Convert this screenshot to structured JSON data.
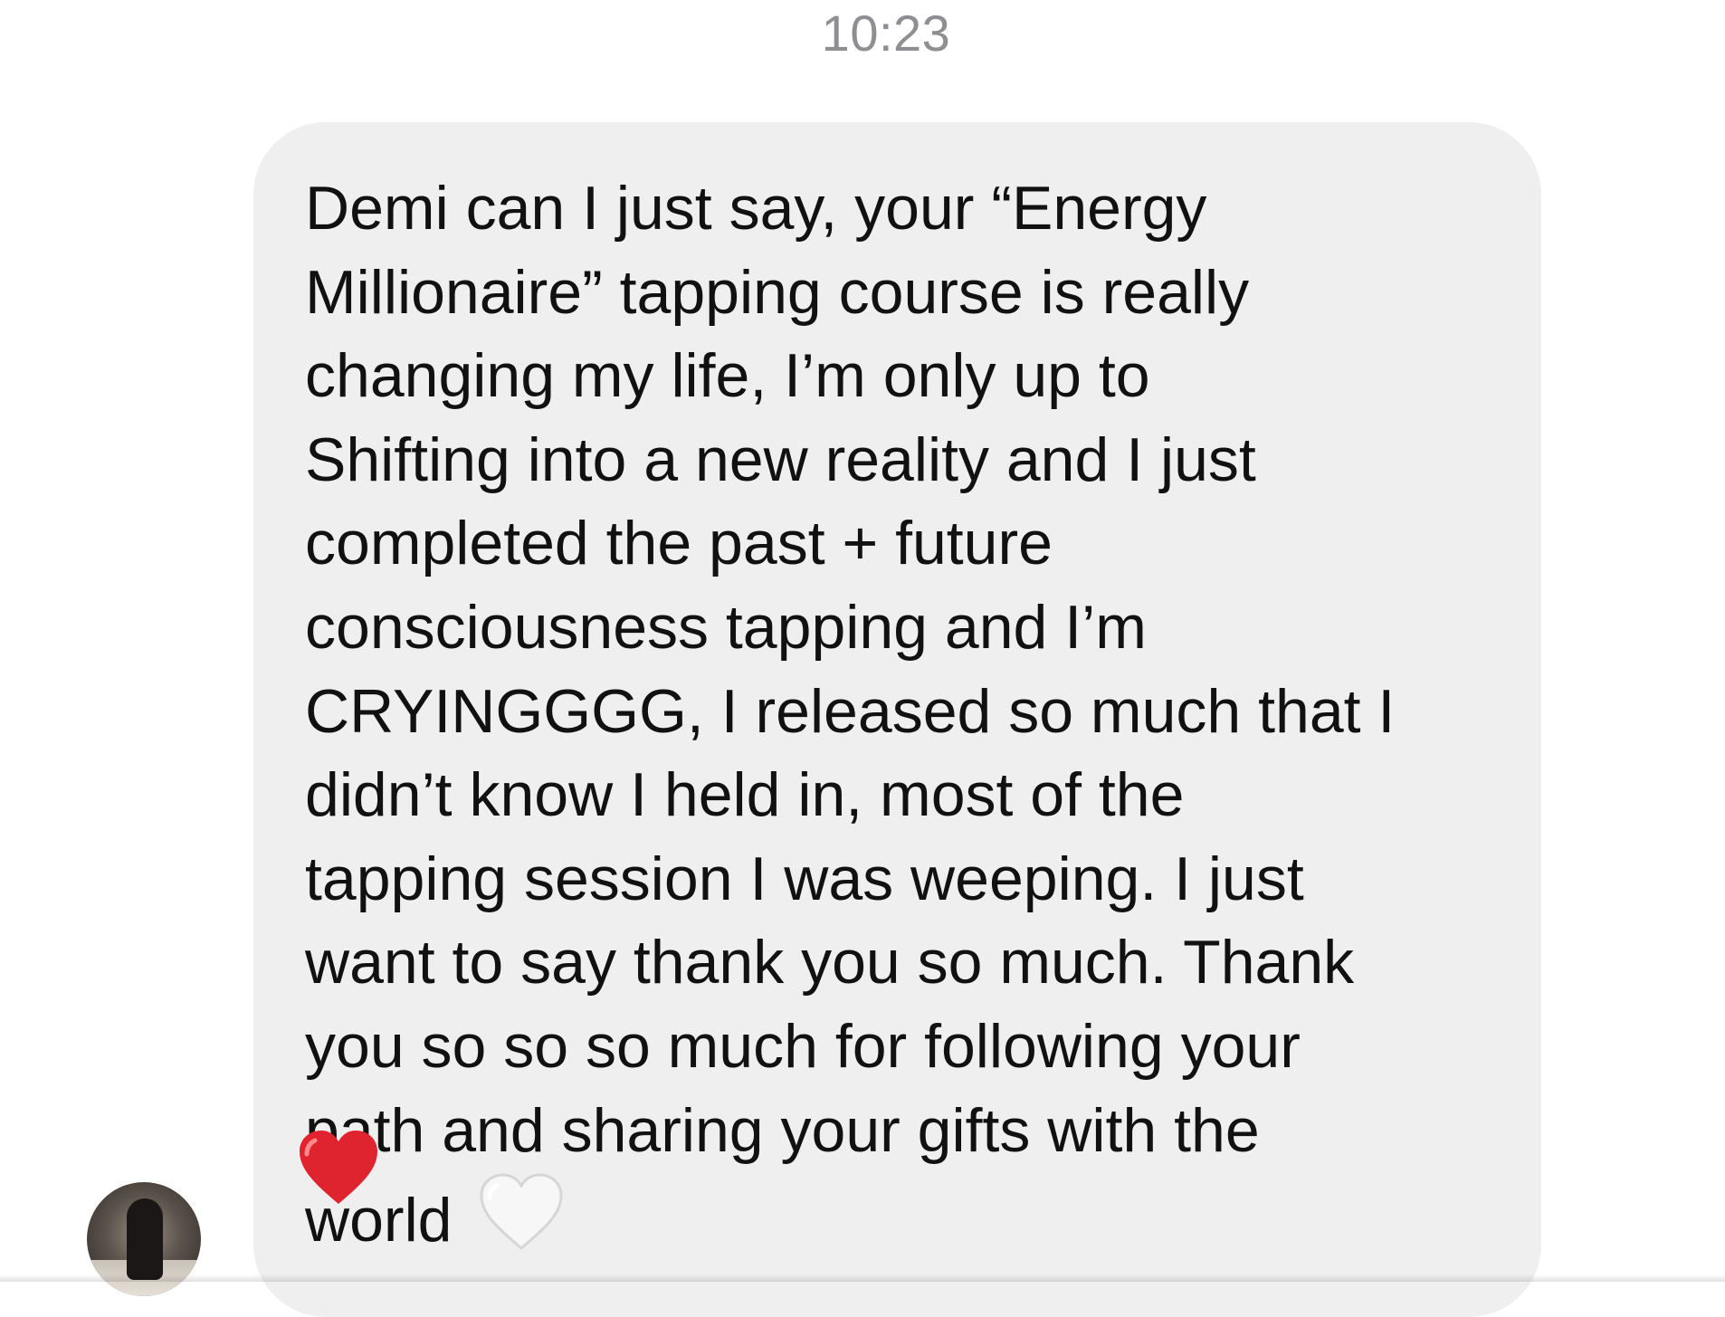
{
  "header": {
    "timestamp": "10:23"
  },
  "message": {
    "lines": [
      "Demi can I just say, your “Energy",
      "Millionaire” tapping course is really",
      "changing my life, I’m only up to",
      "Shifting into a new reality and I just",
      "completed the past + future",
      "consciousness tapping and I’m",
      "CRYINGGGG, I released so much that I",
      "didn’t know I held in, most of the",
      "tapping session I was weeping. I just",
      "want to say thank you so much. Thank",
      "you so so so much for following your",
      "path and sharing your gifts with the",
      "world"
    ],
    "trailing_emoji": "white-heart-icon",
    "reaction": "red-heart-icon"
  },
  "sender": {
    "avatar": "user-avatar"
  },
  "colors": {
    "bubble": "#efefef",
    "text": "#111111",
    "timestamp": "#8e8e93",
    "reaction_heart": "#e0242f"
  }
}
